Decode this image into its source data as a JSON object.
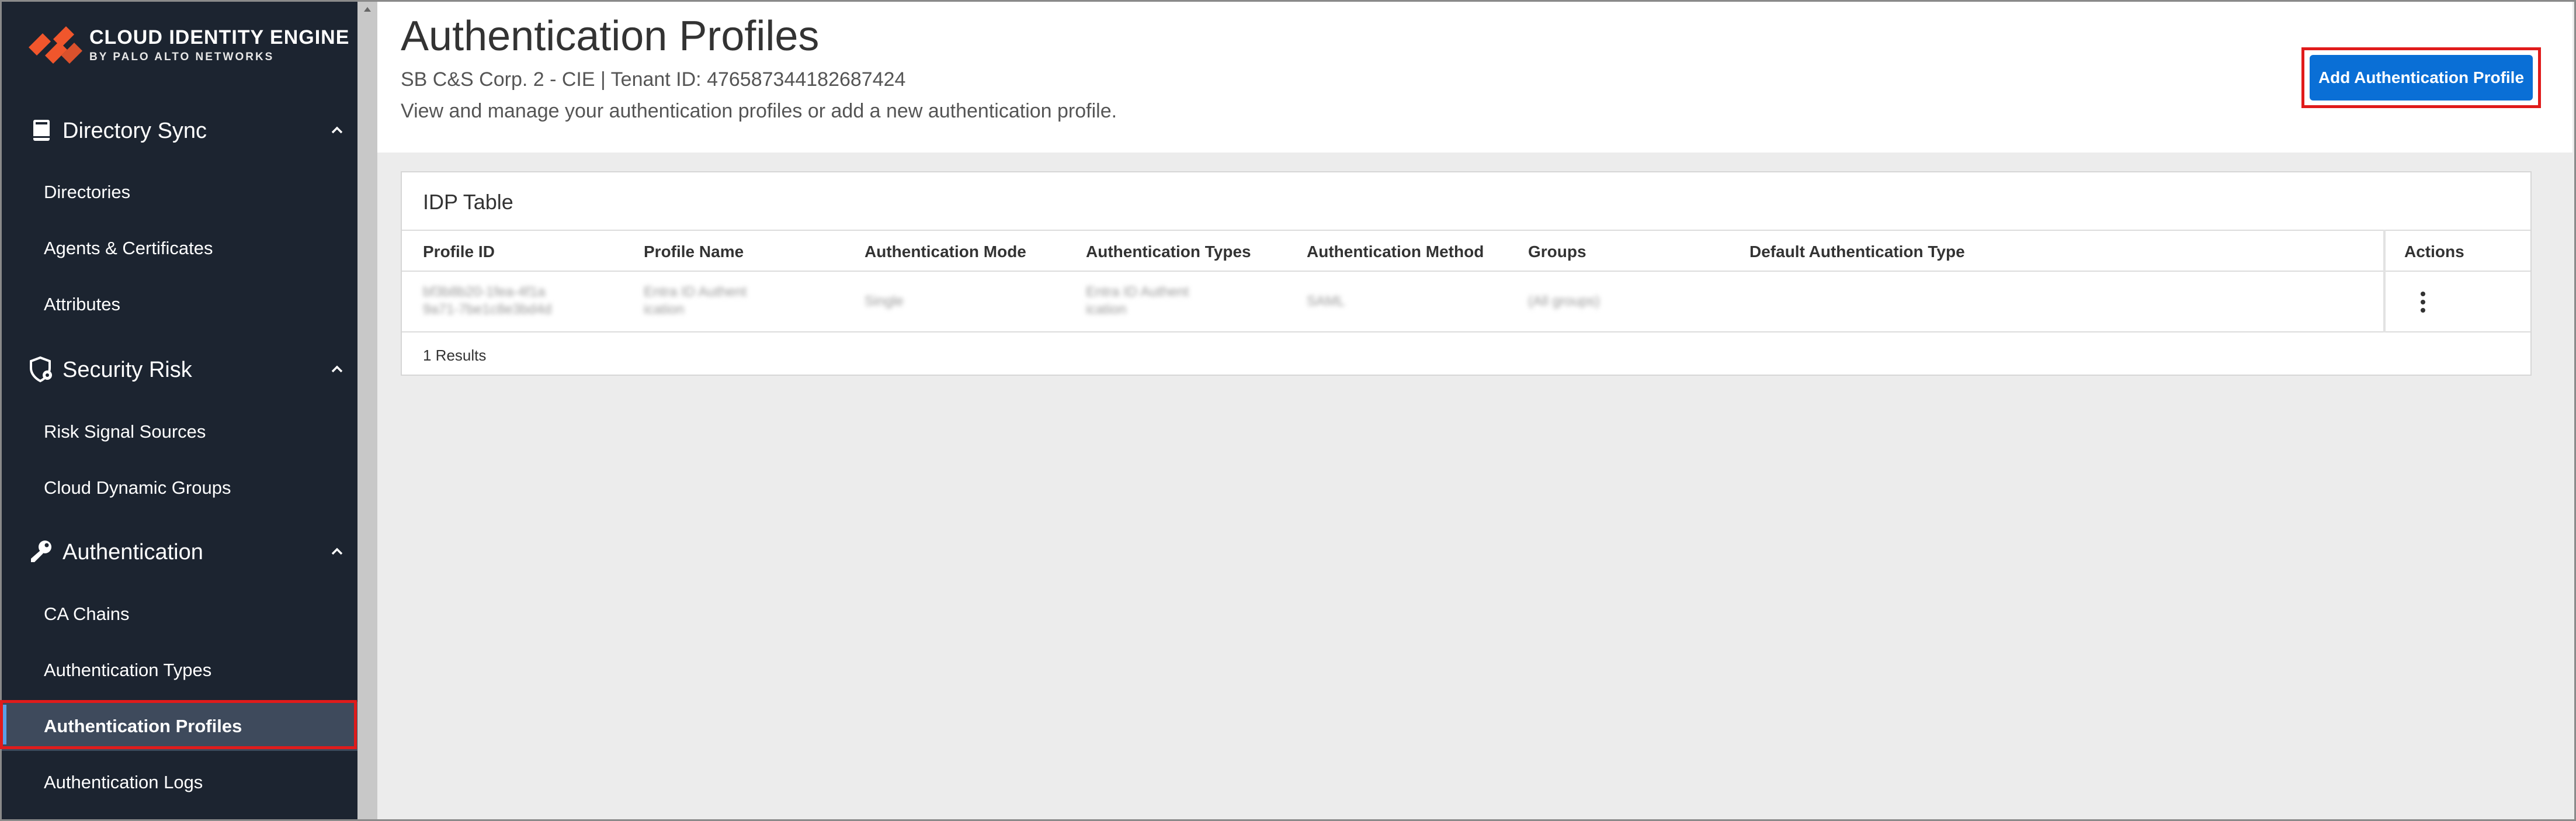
{
  "brand": {
    "title": "CLOUD IDENTITY ENGINE",
    "subtitle": "BY PALO ALTO NETWORKS",
    "accent": "#f0562c"
  },
  "sidebar": {
    "sections": [
      {
        "label": "Directory Sync",
        "icon": "book-icon",
        "items": [
          "Directories",
          "Agents & Certificates",
          "Attributes"
        ]
      },
      {
        "label": "Security Risk",
        "icon": "shield-gear-icon",
        "items": [
          "Risk Signal Sources",
          "Cloud Dynamic Groups"
        ]
      },
      {
        "label": "Authentication",
        "icon": "key-icon",
        "items": [
          "CA Chains",
          "Authentication Types",
          "Authentication Profiles",
          "Authentication Logs"
        ]
      }
    ],
    "active_item": "Authentication Profiles"
  },
  "header": {
    "title": "Authentication Profiles",
    "subtitle": "SB C&S Corp. 2 - CIE | Tenant ID: 476587344182687424",
    "description": "View and manage your authentication profiles or add a new authentication profile.",
    "add_button": "Add Authentication Profile"
  },
  "table": {
    "title": "IDP Table",
    "columns": [
      "Profile ID",
      "Profile Name",
      "Authentication Mode",
      "Authentication Types",
      "Authentication Method",
      "Groups",
      "Default Authentication Type",
      "Actions"
    ],
    "rows": [
      {
        "profile_id": [
          "bf3b8b20-1fea-4f1a",
          "9a71-7be1c8e3bd4d"
        ],
        "profile_name": [
          "Entra ID Authent",
          "ication"
        ],
        "mode": "Single",
        "types": [
          "Entra ID Authent",
          "ication"
        ],
        "method": "SAML",
        "groups": "(All groups)",
        "default_type": ""
      }
    ],
    "results": "1 Results"
  }
}
